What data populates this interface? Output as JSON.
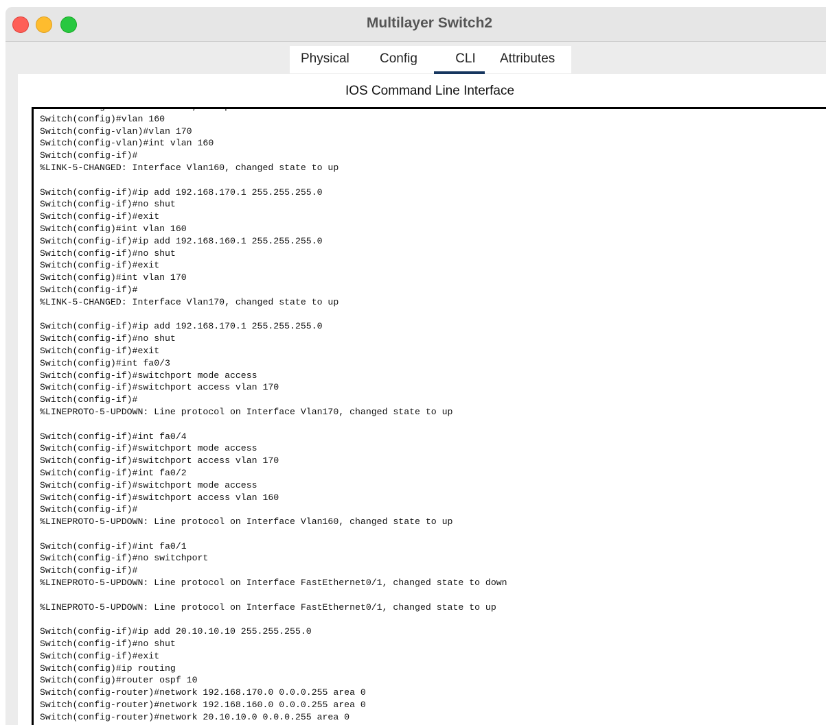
{
  "window": {
    "title": "Multilayer Switch2"
  },
  "tabs": [
    {
      "label": "Physical"
    },
    {
      "label": "Config"
    },
    {
      "label": "CLI",
      "active": true
    },
    {
      "label": "Attributes"
    }
  ],
  "cli": {
    "section_title": "IOS Command Line Interface",
    "lines": [
      "Enter configuration commands, one per line.  End with CNTL/Z.",
      "Switch(config)#vlan 160",
      "Switch(config-vlan)#vlan 170",
      "Switch(config-vlan)#int vlan 160",
      "Switch(config-if)#",
      "%LINK-5-CHANGED: Interface Vlan160, changed state to up",
      "",
      "Switch(config-if)#ip add 192.168.170.1 255.255.255.0",
      "Switch(config-if)#no shut",
      "Switch(config-if)#exit",
      "Switch(config)#int vlan 160",
      "Switch(config-if)#ip add 192.168.160.1 255.255.255.0",
      "Switch(config-if)#no shut",
      "Switch(config-if)#exit",
      "Switch(config)#int vlan 170",
      "Switch(config-if)#",
      "%LINK-5-CHANGED: Interface Vlan170, changed state to up",
      "",
      "Switch(config-if)#ip add 192.168.170.1 255.255.255.0",
      "Switch(config-if)#no shut",
      "Switch(config-if)#exit",
      "Switch(config)#int fa0/3",
      "Switch(config-if)#switchport mode access",
      "Switch(config-if)#switchport access vlan 170",
      "Switch(config-if)#",
      "%LINEPROTO-5-UPDOWN: Line protocol on Interface Vlan170, changed state to up",
      "",
      "Switch(config-if)#int fa0/4",
      "Switch(config-if)#switchport mode access",
      "Switch(config-if)#switchport access vlan 170",
      "Switch(config-if)#int fa0/2",
      "Switch(config-if)#switchport mode access",
      "Switch(config-if)#switchport access vlan 160",
      "Switch(config-if)#",
      "%LINEPROTO-5-UPDOWN: Line protocol on Interface Vlan160, changed state to up",
      "",
      "Switch(config-if)#int fa0/1",
      "Switch(config-if)#no switchport",
      "Switch(config-if)#",
      "%LINEPROTO-5-UPDOWN: Line protocol on Interface FastEthernet0/1, changed state to down",
      "",
      "%LINEPROTO-5-UPDOWN: Line protocol on Interface FastEthernet0/1, changed state to up",
      "",
      "Switch(config-if)#ip add 20.10.10.10 255.255.255.0",
      "Switch(config-if)#no shut",
      "Switch(config-if)#exit",
      "Switch(config)#ip routing",
      "Switch(config)#router ospf 10",
      "Switch(config-router)#network 192.168.170.0 0.0.0.255 area 0",
      "Switch(config-router)#network 192.168.160.0 0.0.0.255 area 0",
      "Switch(config-router)#network 20.10.10.0 0.0.0.255 area 0"
    ]
  },
  "colors": {
    "close": "#fe5f57",
    "minimize": "#febc2e",
    "maximize": "#28c840",
    "active_tab_underline": "#16365f"
  }
}
